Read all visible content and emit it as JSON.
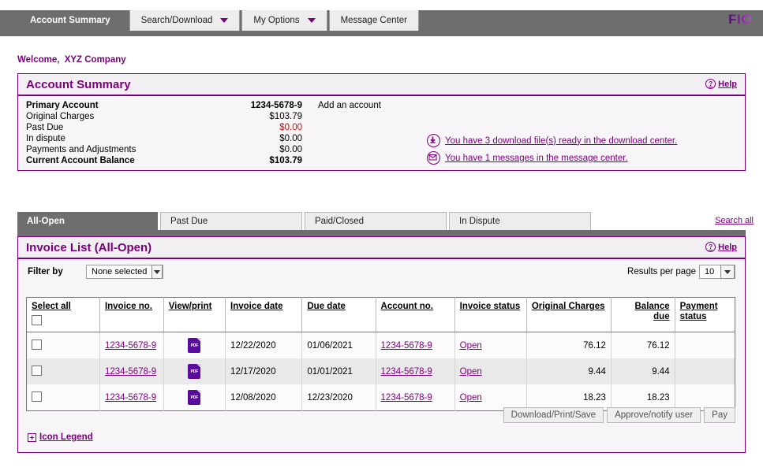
{
  "brand": {
    "name": "FIO"
  },
  "nav": {
    "tabs": [
      {
        "label": "Account Summary",
        "active": true,
        "caret": false
      },
      {
        "label": "Search/Download",
        "active": false,
        "caret": true
      },
      {
        "label": "My Options",
        "active": false,
        "caret": true
      },
      {
        "label": "Message Center",
        "active": false,
        "caret": false
      }
    ]
  },
  "welcome": {
    "greeting": "Welcome,",
    "company": "XYZ Company"
  },
  "account_summary": {
    "title": "Account Summary",
    "help_label": "Help",
    "rows": [
      {
        "label": "Primary Account",
        "value": "1234-5678-9",
        "bold": true,
        "extra": "Add an account"
      },
      {
        "label": "Original Charges",
        "value": "$103.79",
        "bold": false
      },
      {
        "label": "Past Due",
        "value": "$0.00",
        "bold": false,
        "red": true
      },
      {
        "label": "In dispute",
        "value": "$0.00",
        "bold": false
      },
      {
        "label": "Payments and Adjustments",
        "value": "$0.00",
        "bold": false
      },
      {
        "label": "Current Account Balance",
        "value": "$103.79",
        "bold": true
      }
    ],
    "notices": [
      {
        "icon": "download-icon",
        "text": "You have 3 download file(s) ready in the download center."
      },
      {
        "icon": "envelope-icon",
        "text": "You have 1 messages in the message center."
      }
    ]
  },
  "invoice_tabs": {
    "tabs": [
      {
        "label": "All-Open",
        "active": true
      },
      {
        "label": "Past Due",
        "active": false
      },
      {
        "label": "Paid/Closed",
        "active": false
      },
      {
        "label": "In Dispute",
        "active": false
      }
    ],
    "search_all_label": "Search all"
  },
  "invoice_list": {
    "title": "Invoice List (All-Open)",
    "help_label": "Help",
    "filter_label": "Filter by",
    "filter_value": "None selected",
    "results_per_page_label": "Results per page",
    "results_per_page_value": "10",
    "columns": [
      "Select all",
      "Invoice no.",
      "View/print",
      "Invoice date",
      "Due date",
      "Account no.",
      "Invoice status",
      "Original Charges",
      "Balance due",
      "Payment status"
    ],
    "rows": [
      {
        "invoice_no": "1234-5678-9",
        "view_print": "pdf-icon",
        "invoice_date": "12/22/2020",
        "due_date": "01/06/2021",
        "account_no": "1234-5678-9",
        "invoice_status": "Open",
        "original_charges": "76.12",
        "balance_due": "76.12",
        "payment_status": ""
      },
      {
        "invoice_no": "1234-5678-9",
        "view_print": "pdf-icon",
        "invoice_date": "12/17/2020",
        "due_date": "01/01/2021",
        "account_no": "1234-5678-9",
        "invoice_status": "Open",
        "original_charges": "9.44",
        "balance_due": "9.44",
        "payment_status": ""
      },
      {
        "invoice_no": "1234-5678-9",
        "view_print": "pdf-icon",
        "invoice_date": "12/08/2020",
        "due_date": "12/23/2020",
        "account_no": "1234-5678-9",
        "invoice_status": "Open",
        "original_charges": "18.23",
        "balance_due": "18.23",
        "payment_status": ""
      }
    ],
    "actions": [
      {
        "label": "Download/Print/Save"
      },
      {
        "label": "Approve/notify user"
      },
      {
        "label": "Pay"
      }
    ],
    "icon_legend_label": "Icon Legend"
  },
  "colors": {
    "accent_purple": "#7b007b",
    "nav_gray": "#6e6e6e",
    "alert_red": "#e00000",
    "pdf_purple": "#5b0a9e"
  }
}
